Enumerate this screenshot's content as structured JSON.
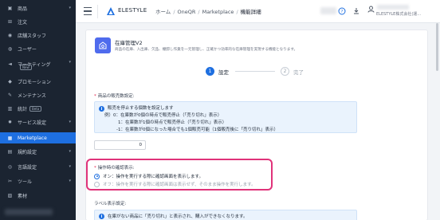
{
  "sidebar": {
    "items": [
      {
        "label": "商品",
        "icon": "box-icon",
        "chevron": true,
        "badge": ""
      },
      {
        "label": "注文",
        "icon": "cart-icon",
        "chevron": false,
        "badge": ""
      },
      {
        "label": "店舗スタッフ",
        "icon": "staff-icon",
        "chevron": false,
        "badge": ""
      },
      {
        "label": "ユーザー",
        "icon": "user-icon",
        "chevron": false,
        "badge": ""
      },
      {
        "label": "マーケティング",
        "icon": "megaphone-icon",
        "chevron": true,
        "badge": "New"
      },
      {
        "label": "プロモーション",
        "icon": "tag-icon",
        "chevron": false,
        "badge": ""
      },
      {
        "label": "メンテナンス",
        "icon": "wrench-icon",
        "chevron": false,
        "badge": ""
      },
      {
        "label": "統計",
        "icon": "chart-icon",
        "chevron": false,
        "badge": "Beta"
      },
      {
        "label": "サービス設定",
        "icon": "gear-icon",
        "chevron": true,
        "badge": ""
      },
      {
        "label": "Marketplace",
        "icon": "grid-icon",
        "chevron": false,
        "badge": "",
        "active": true
      },
      {
        "label": "規約設定",
        "icon": "document-icon",
        "chevron": true,
        "badge": ""
      },
      {
        "label": "言語設定",
        "icon": "globe-icon",
        "chevron": true,
        "badge": ""
      },
      {
        "label": "ツール",
        "icon": "tool-icon",
        "chevron": true,
        "badge": ""
      },
      {
        "label": "素材",
        "icon": "image-icon",
        "chevron": false,
        "badge": ""
      }
    ]
  },
  "topbar": {
    "brand": "ELESTYLE",
    "breadcrumb": [
      "ホーム",
      "OneQR",
      "Marketplace",
      "機能詳細"
    ],
    "user_label": "ELESTYLE株式会社(運..."
  },
  "app": {
    "title": "在庫管理V2",
    "description": "商品の在庫、入出庫、欠品、棚卸し作業を一元管理し、正確かつ効率的な在庫管理を実現する機能となります。"
  },
  "steps": [
    {
      "number": "1",
      "label": "設定"
    },
    {
      "number": "2",
      "label": "完了"
    }
  ],
  "sale_setting": {
    "label": "商品の販売数設定:",
    "info_lines": [
      "販売を停止する個数を設定します",
      "例）0：在庫数が0個の時点で販売停止（「売り切れ」表示）",
      "1：在庫数が1個の時点で販売停止（「売り切れ」表示）",
      "-1：在庫数が0個になった場合でも1個販売可能（1個販売後に「売り切れ」表示）"
    ],
    "value": "0"
  },
  "confirm_setting": {
    "label": "操作時の確認表示:",
    "options": [
      {
        "label": "オン：操作を実行する際に確認画面を表示します。",
        "checked": true
      },
      {
        "label": "オフ：操作を実行する際に確認画面は表示せず、そのまま操作を実行します。",
        "checked": false
      }
    ]
  },
  "label_setting": {
    "label": "ラベル表示設定:",
    "info_line": "在庫がない商品に「売り切れ」と表示され、購入ができなくなります。"
  },
  "colors": {
    "sidebar_bg": "#1b2431",
    "accent": "#1e6fe0",
    "highlight": "#e0337a"
  }
}
